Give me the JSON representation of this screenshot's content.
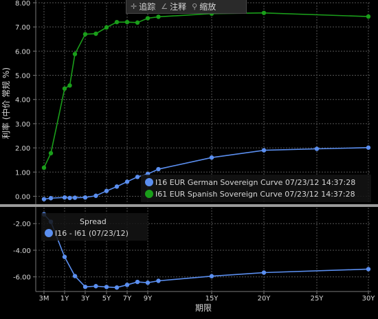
{
  "toolbar": {
    "items": [
      {
        "label": "追踪",
        "icon": "crosshair-icon"
      },
      {
        "label": "注释",
        "icon": "pencil-icon"
      },
      {
        "label": "缩放",
        "icon": "magnifier-icon"
      }
    ]
  },
  "colors": {
    "german": "#5b8ff0",
    "spanish": "#1a9e1a",
    "spread": "#5b8ff0",
    "text": "#d8d8d8",
    "grid": "#555555"
  },
  "chart_data": [
    {
      "type": "line",
      "ylabel": "利率 (中价 常规 %)",
      "xlabel": "期限",
      "ylim": [
        -0.3,
        8.0
      ],
      "yticks": [
        0.0,
        1.0,
        2.0,
        3.0,
        4.0,
        5.0,
        6.0,
        7.0,
        8.0
      ],
      "ytick_labels": [
        "0.00",
        "1.00",
        "2.00",
        "3.00",
        "4.00",
        "5.00",
        "6.00",
        "7.00",
        "8.00"
      ],
      "x_ticks": [
        "3M",
        "1Y",
        "3Y",
        "5Y",
        "7Y",
        "9Y",
        "15Y",
        "20Y",
        "25Y",
        "30Y"
      ],
      "grid": true,
      "legend_placement": "bottom-right",
      "series": [
        {
          "name": "I16 EUR German Sovereign Curve 07/23/12 14:37:28",
          "points": [
            [
              "3M",
              -0.12
            ],
            [
              "6M",
              -0.08
            ],
            [
              "1Y",
              -0.05
            ],
            [
              "18M",
              -0.07
            ],
            [
              "2Y",
              -0.06
            ],
            [
              "3Y",
              -0.05
            ],
            [
              "4Y",
              0.02
            ],
            [
              "5Y",
              0.22
            ],
            [
              "6Y",
              0.4
            ],
            [
              "7Y",
              0.6
            ],
            [
              "8Y",
              0.8
            ],
            [
              "9Y",
              0.92
            ],
            [
              "10Y",
              1.12
            ],
            [
              "15Y",
              1.6
            ],
            [
              "20Y",
              1.9
            ],
            [
              "25Y",
              1.96
            ],
            [
              "30Y",
              2.01
            ]
          ]
        },
        {
          "name": "I61 EUR Spanish Sovereign Curve 07/23/12 14:37:28",
          "points": [
            [
              "3M",
              1.18
            ],
            [
              "6M",
              1.78
            ],
            [
              "1Y",
              4.45
            ],
            [
              "18M",
              4.58
            ],
            [
              "2Y",
              5.88
            ],
            [
              "3Y",
              6.7
            ],
            [
              "4Y",
              6.72
            ],
            [
              "5Y",
              6.98
            ],
            [
              "6Y",
              7.2
            ],
            [
              "7Y",
              7.2
            ],
            [
              "8Y",
              7.18
            ],
            [
              "9Y",
              7.36
            ],
            [
              "10Y",
              7.42
            ],
            [
              "15Y",
              7.55
            ],
            [
              "20Y",
              7.58
            ],
            [
              "30Y",
              7.43
            ]
          ]
        }
      ]
    },
    {
      "type": "line",
      "xlabel": "期限",
      "ylim": [
        -7.1,
        -0.8
      ],
      "yticks": [
        -2.0,
        -4.0,
        -6.0
      ],
      "ytick_labels": [
        "-2.00",
        "-4.00",
        "-6.00"
      ],
      "x_ticks": [
        "3M",
        "1Y",
        "3Y",
        "5Y",
        "7Y",
        "9Y",
        "15Y",
        "20Y",
        "25Y",
        "30Y"
      ],
      "grid": true,
      "legend_placement": "top-left",
      "legend_title": "Spread",
      "series": [
        {
          "name": "I16 - I61 (07/23/12)",
          "points": [
            [
              "3M",
              -1.3
            ],
            [
              "6M",
              -1.86
            ],
            [
              "1Y",
              -4.5
            ],
            [
              "2Y",
              -5.94
            ],
            [
              "3Y",
              -6.75
            ],
            [
              "4Y",
              -6.7
            ],
            [
              "5Y",
              -6.76
            ],
            [
              "6Y",
              -6.8
            ],
            [
              "7Y",
              -6.6
            ],
            [
              "8Y",
              -6.38
            ],
            [
              "9Y",
              -6.44
            ],
            [
              "10Y",
              -6.3
            ],
            [
              "15Y",
              -5.95
            ],
            [
              "20Y",
              -5.68
            ],
            [
              "30Y",
              -5.42
            ]
          ]
        }
      ]
    }
  ]
}
